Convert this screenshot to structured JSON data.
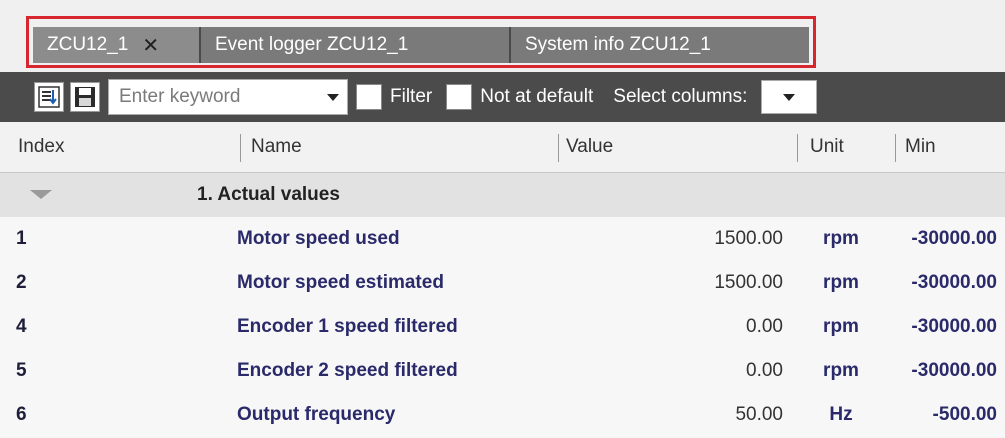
{
  "tabs": [
    {
      "label": "ZCU12_1",
      "closable": true,
      "active": true
    },
    {
      "label": "Event logger ZCU12_1",
      "closable": false,
      "active": false
    },
    {
      "label": "System info ZCU12_1",
      "closable": false,
      "active": false
    }
  ],
  "toolbar": {
    "search_placeholder": "Enter keyword",
    "filter_label": "Filter",
    "not_at_default_label": "Not at default",
    "select_columns_label": "Select columns:",
    "icons": [
      "refresh-icon",
      "save-icon"
    ]
  },
  "columns": [
    "Index",
    "Name",
    "Value",
    "Unit",
    "Min"
  ],
  "group": {
    "title": "1. Actual values",
    "expanded": true
  },
  "rows": [
    {
      "index": "1",
      "name": "Motor speed used",
      "value": "1500.00",
      "unit": "rpm",
      "min": "-30000.00"
    },
    {
      "index": "2",
      "name": "Motor speed estimated",
      "value": "1500.00",
      "unit": "rpm",
      "min": "-30000.00"
    },
    {
      "index": "4",
      "name": "Encoder 1 speed filtered",
      "value": "0.00",
      "unit": "rpm",
      "min": "-30000.00"
    },
    {
      "index": "5",
      "name": "Encoder 2 speed filtered",
      "value": "0.00",
      "unit": "rpm",
      "min": "-30000.00"
    },
    {
      "index": "6",
      "name": "Output frequency",
      "value": "50.00",
      "unit": "Hz",
      "min": "-500.00"
    }
  ],
  "colors": {
    "highlight_outline": "#d6262e",
    "toolbar_bg": "#4b4b4b",
    "tab_bg": "#7a7a7a",
    "text_accent": "#2a2a6a"
  }
}
